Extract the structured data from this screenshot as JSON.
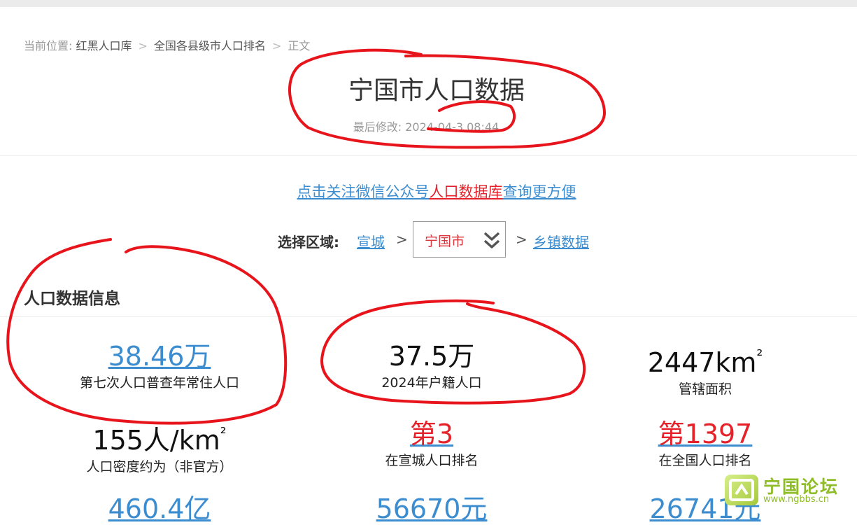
{
  "breadcrumb": {
    "prefix": "当前位置:",
    "items": [
      "红黑人口库",
      "全国各县级市人口排名",
      "正文"
    ],
    "separator": ">"
  },
  "article": {
    "title": "宁国市人口数据",
    "modified": "最后修改: 2024-04-3 08:44"
  },
  "follow_link": {
    "before": "点击关注微信公众号",
    "highlight": "人口数据库",
    "after": "查询更方便"
  },
  "region_selector": {
    "label": "选择区域:",
    "parent": "宣城",
    "separator": ">",
    "selected": "宁国市",
    "child": "乡镇数据"
  },
  "section": {
    "title": "人口数据信息"
  },
  "stats": [
    {
      "value": "38.46万",
      "label": "第七次人口普查年常住人口"
    },
    {
      "value": "37.5万",
      "label": "2024年户籍人口"
    },
    {
      "value": "2447km",
      "sup": "²",
      "label": "管辖面积"
    },
    {
      "value": "155人/km",
      "sup": "²",
      "label": "人口密度约为（非官方）"
    },
    {
      "value": "第3",
      "label": "在宣城人口排名"
    },
    {
      "value": "第1397",
      "label": "在全国人口排名"
    },
    {
      "value": "460.4亿",
      "label": ""
    },
    {
      "value": "56670元",
      "label": ""
    },
    {
      "value": "26741元",
      "label": ""
    }
  ],
  "watermark": {
    "name": "宁国论坛",
    "url": "www.ngbbs.cn"
  },
  "colors": {
    "link": "#3c8dd0",
    "highlight": "#e5212a",
    "annotation": "#e8141c",
    "watermark": "#8fbd2a"
  },
  "icons": {
    "select_arrow": "double-chevron-down-icon",
    "logo": "forum-logo-icon"
  }
}
